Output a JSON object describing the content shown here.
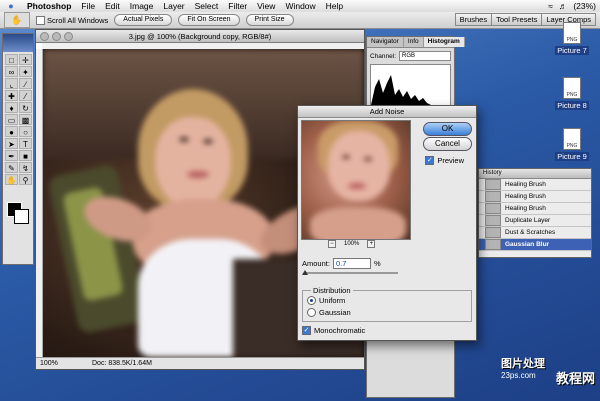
{
  "menubar": {
    "app": "Photoshop",
    "items": [
      "File",
      "Edit",
      "Image",
      "Layer",
      "Select",
      "Filter",
      "View",
      "Window",
      "Help"
    ],
    "battery": "(23%)"
  },
  "options_bar": {
    "scroll_all": "Scroll All Windows",
    "buttons": [
      "Actual Pixels",
      "Fit On Screen",
      "Print Size"
    ],
    "wells": [
      "Brushes",
      "Tool Presets",
      "Layer Comps"
    ]
  },
  "document": {
    "title": "3.jpg @ 100% (Background copy, RGB/8#)",
    "zoom": "100%",
    "doc_size": "Doc: 838.5K/1.64M"
  },
  "navigator": {
    "tabs": [
      "Navigator",
      "Info",
      "Histogram"
    ],
    "channel_label": "Channel:",
    "channel_value": "RGB"
  },
  "history": {
    "title": "History",
    "items": [
      "Healing Brush",
      "Healing Brush",
      "Healing Brush",
      "Duplicate Layer",
      "Dust & Scratches",
      "Gaussian Blur"
    ],
    "selected_index": 5
  },
  "desktop_icons": [
    "Picture 7",
    "Picture 8",
    "Picture 9"
  ],
  "dialog": {
    "title": "Add Noise",
    "ok": "OK",
    "cancel": "Cancel",
    "preview_label": "Preview",
    "preview_zoom": "100%",
    "amount_label": "Amount:",
    "amount_value": "0.7",
    "amount_unit": "%",
    "distribution_label": "Distribution",
    "uniform": "Uniform",
    "gaussian": "Gaussian",
    "monochromatic": "Monochromatic",
    "selected_distribution": "Uniform"
  },
  "watermark": {
    "line1": "图片处理",
    "line2": "23ps.com",
    "line3": "教程网"
  },
  "colors": {
    "accent": "#3b78d2",
    "desktop": "#2f5fa8"
  }
}
